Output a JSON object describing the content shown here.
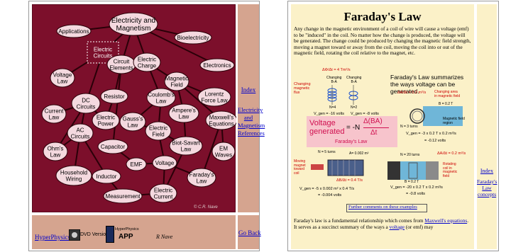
{
  "left_panel": {
    "concept_nodes": [
      {
        "label": "Electricity and\nMagnetism"
      },
      {
        "label": "Applications"
      },
      {
        "label": "Bioelectricity"
      },
      {
        "label": "Electric\nCircuits"
      },
      {
        "label": "Circuit\nElements"
      },
      {
        "label": "Electric\nCharge"
      },
      {
        "label": "Electronics"
      },
      {
        "label": "Voltage\nLaw"
      },
      {
        "label": "Magnetic\nField"
      },
      {
        "label": "DC\nCircuits"
      },
      {
        "label": "Resistor"
      },
      {
        "label": "Coulomb's\nLaw"
      },
      {
        "label": "Lorentz\nForce Law"
      },
      {
        "label": "Current\nLaw"
      },
      {
        "label": "Electric\nPower"
      },
      {
        "label": "Gauss's\nLaw"
      },
      {
        "label": "Ampere's\nLaw"
      },
      {
        "label": "Maxwell's\nEquations"
      },
      {
        "label": "AC\nCircuits"
      },
      {
        "label": "Electric\nField"
      },
      {
        "label": "Ohm's\nLaw"
      },
      {
        "label": "Capacitor"
      },
      {
        "label": "Biot-Savart\nLaw"
      },
      {
        "label": "EM\nWaves"
      },
      {
        "label": "EMF"
      },
      {
        "label": "Voltage"
      },
      {
        "label": "Household\nWiring"
      },
      {
        "label": "Inductor"
      },
      {
        "label": "Faraday's\nLaw"
      },
      {
        "label": "Electric\nCurrent"
      },
      {
        "label": "Measurement"
      }
    ],
    "copyright": "© C.R. Nave",
    "side_links": {
      "index": "Index",
      "topic": "Electricity\nand\nMagnetism\nReferences"
    },
    "footer": {
      "hyperphysics_link": "HyperPhysics",
      "dvd_label": "DVD Version",
      "app_label_top": "HyperPhysics",
      "app_label": "APP",
      "author": "R Nave",
      "go_back": "Go Back"
    }
  },
  "right_panel": {
    "title": "Faraday's Law",
    "intro": "Any change in the magnetic environment of a coil of wire will cause a voltage (emf) to be \"induced\" in the coil. No matter how the change is produced, the voltage will be generated. The change could be produced by changing the magnetic field strength, moving a magnet toward or away from the coil, moving the coil into or out of the magnetic field, rotating the coil relative to the magnet, etc.",
    "summary": "Faraday's Law summarizes the ways voltage can be generated.",
    "formula_left": "Voltage\ngenerated",
    "formula_eq": "= -N",
    "formula_num": "Δ(BA)",
    "formula_den": "Δt",
    "formula_caption": "Faraday's Law",
    "diagram_labels": {
      "changing_flux": "Changing\nmagnetic\nflux",
      "dphi_top": "ΔΦ/Δt = 4 Tm²/s",
      "changing_a": "Changing\nB-A",
      "changing_b": "Changing\nB-A",
      "n1": "N=4",
      "n2": "N=2",
      "vgen1": "V_gen = -16 volts",
      "vgen2": "V_gen = -8 volts",
      "changing_area": "Changing area\nin magnetic field",
      "dA": "ΔA/Δt = 0.2 m²/s",
      "b_field": "B = 0.2 T",
      "n3": "N = 3 turns",
      "mag_field_region": "Magnetic field\nregion",
      "vgen3": "V_gen = -3 x 0.2 T x 0.2 m²/s",
      "vgen3b": "= -0.12 volts",
      "n5": "N = 5 turns",
      "area": "A= 0.002 m²",
      "moving_magnet": "Moving\nmagnet\ntoward\ncoil",
      "dB": "ΔB/Δt = 0.4 T/s",
      "vgen4": "V_gen = -5 x 0.002 m² x 0.4 T/s",
      "vgen4b": "= -0.004 volts",
      "n20": "N = 20 turns",
      "dA2": "ΔA/Δt = 0.2 m²/s",
      "b2": "B = 0.2 T",
      "rotating": "Rotating\ncoil in\nmagnetic\nfield",
      "vgen5": "V_gen = -20 x 0.2 T x 0.2 m²/s",
      "vgen5b": "= -0.8 volts"
    },
    "further_link": "Further comments on these examples",
    "bottom_text_1": "Faraday's law is a fundamental relationship which comes from ",
    "bottom_link_1": "Maxwell's equations",
    "bottom_text_2": ". It serves as a succinct summary of the ways a ",
    "bottom_link_2": "voltage",
    "bottom_text_3": " (or emf) may",
    "side_links": {
      "index": "Index",
      "topic": "Faraday's\nLaw\nconcepts"
    }
  }
}
